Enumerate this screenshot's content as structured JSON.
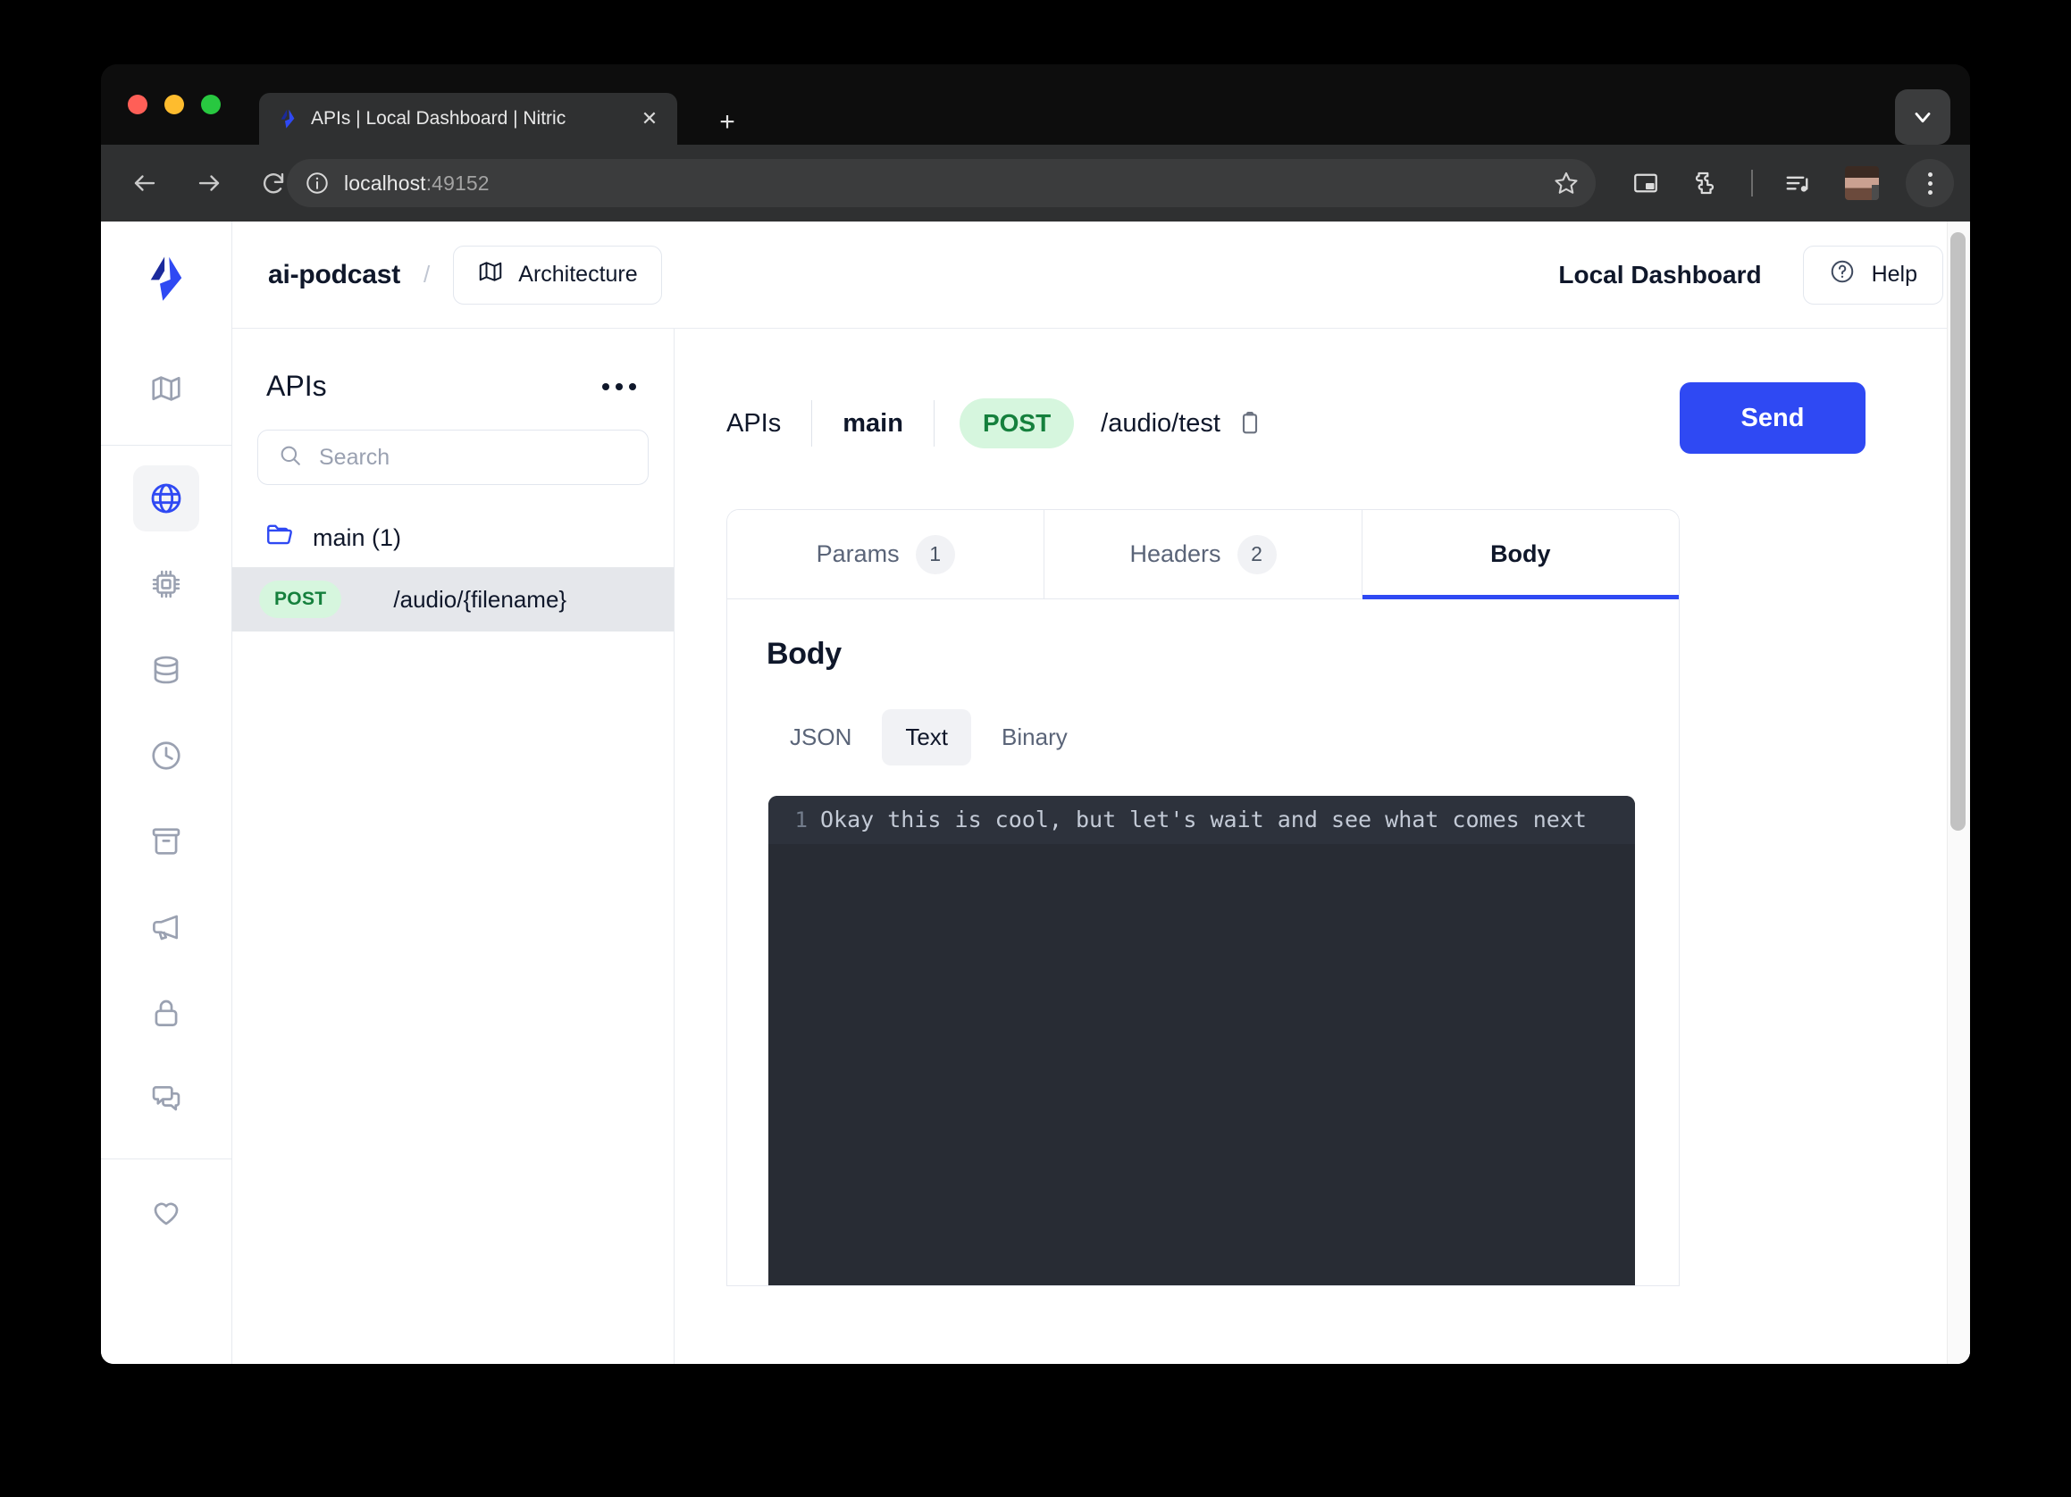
{
  "browser": {
    "tab": {
      "title": "APIs | Local Dashboard | Nitric",
      "favicon_icon": "nitric-logo-icon",
      "close_icon": "close-icon"
    },
    "new_tab_icon": "plus-icon",
    "tab_list_chevron_icon": "chevron-down-icon",
    "back_icon": "back-arrow-icon",
    "forward_icon": "forward-arrow-icon",
    "reload_icon": "reload-icon",
    "site_info_icon": "info-circle-icon",
    "url": "localhost",
    "url_port": ":49152",
    "bookmark_icon": "star-icon",
    "pip_icon": "picture-in-picture-icon",
    "extensions_icon": "puzzle-piece-icon",
    "media_icon": "media-playlist-icon",
    "avatar_icon": "profile-avatar",
    "menu_icon": "three-dot-menu-icon"
  },
  "rail": {
    "logo_icon": "nitric-logo-icon",
    "items": [
      {
        "name": "architecture",
        "icon": "map-icon",
        "active": false
      },
      {
        "name": "apis",
        "icon": "globe-icon",
        "active": true
      },
      {
        "name": "services",
        "icon": "cpu-chip-icon",
        "active": false
      },
      {
        "name": "databases",
        "icon": "database-icon",
        "active": false
      },
      {
        "name": "schedules",
        "icon": "clock-icon",
        "active": false
      },
      {
        "name": "storage",
        "icon": "archive-box-icon",
        "active": false
      },
      {
        "name": "topics",
        "icon": "megaphone-icon",
        "active": false
      },
      {
        "name": "secrets",
        "icon": "lock-icon",
        "active": false
      },
      {
        "name": "websockets",
        "icon": "chat-bubbles-icon",
        "active": false
      },
      {
        "name": "sponsor",
        "icon": "heart-icon",
        "active": false
      }
    ]
  },
  "header": {
    "project_name": "ai-podcast",
    "separator": "/",
    "architecture_label": "Architecture",
    "architecture_icon": "map-icon",
    "dashboard_label": "Local Dashboard",
    "help_label": "Help",
    "help_icon": "question-circle-icon"
  },
  "list_panel": {
    "title": "APIs",
    "more_icon": "three-dots-horizontal-icon",
    "search_placeholder": "Search",
    "search_value": "",
    "search_icon": "search-icon",
    "folder": {
      "label": "main (1)",
      "icon": "folder-icon"
    },
    "routes": [
      {
        "method": "POST",
        "path": "/audio/{filename}",
        "selected": true
      }
    ]
  },
  "request": {
    "breadcrumb_apis": "APIs",
    "breadcrumb_api": "main",
    "method": "POST",
    "path": "/audio/test",
    "copy_icon": "clipboard-copy-icon",
    "send_label": "Send"
  },
  "tabs": [
    {
      "label": "Params",
      "count": "1",
      "active": false
    },
    {
      "label": "Headers",
      "count": "2",
      "active": false
    },
    {
      "label": "Body",
      "count": "",
      "active": true
    }
  ],
  "body_panel": {
    "title": "Body",
    "formats": [
      {
        "label": "JSON",
        "active": false
      },
      {
        "label": "Text",
        "active": true
      },
      {
        "label": "Binary",
        "active": false
      }
    ],
    "editor": {
      "line_number": "1",
      "content": "Okay this is cool, but let's wait and see what comes next"
    }
  },
  "colors": {
    "accent": "#2f49f3",
    "method_post_bg": "#d6f6de",
    "method_post_text": "#15803d",
    "editor_bg": "#282c34",
    "text_primary": "#0f172a"
  }
}
